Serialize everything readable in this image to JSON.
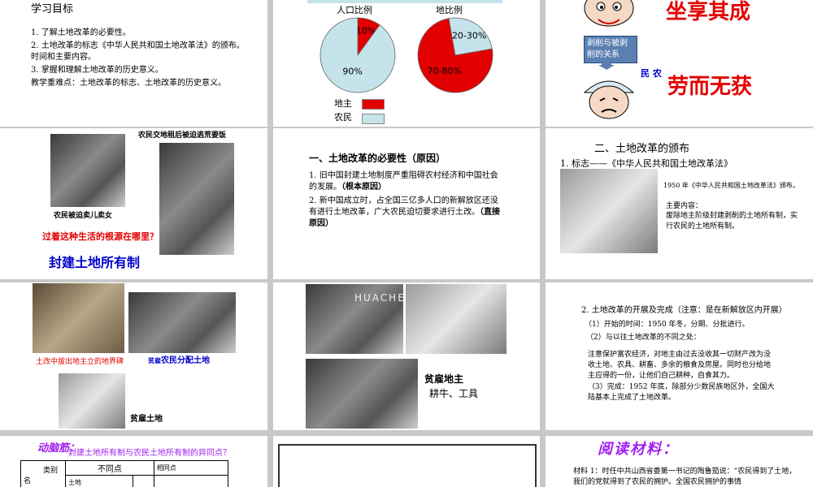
{
  "colors": {
    "red": "#e30000",
    "pale_blue": "#c5e3ea",
    "gray_bg": "#c8c8c8",
    "blue_label": "#0000cc",
    "purple": "#a020f0"
  },
  "s1": {
    "title": "学习目标",
    "items": [
      "1. 了解土地改革的必要性。",
      "2. 土地改革的标志《中华人民共和国土地改革法》的颁布。时间和主要内容。",
      "3. 掌握和理解土地改革的历史意义。"
    ],
    "key": "教学重难点：土地改革的标志、土地改革的历史意义。"
  },
  "s2": {
    "pie1_title": "人口比例",
    "pie2_title": "地比例",
    "legend_landlord": "地主",
    "legend_peasant": "农民"
  },
  "chart_data": [
    {
      "type": "pie",
      "title": "人口比例",
      "labels": [
        "地主",
        "农民"
      ],
      "values": [
        10,
        90
      ],
      "value_labels": [
        "10%",
        "90%"
      ]
    },
    {
      "type": "pie",
      "title": "地比例",
      "labels": [
        "地主",
        "农民"
      ],
      "values": [
        75,
        25
      ],
      "value_labels": [
        "70-80%",
        "20-30%"
      ]
    }
  ],
  "s3": {
    "top_text": "坐享其成",
    "box_label": "剥削与被剥削的关系",
    "peasant_label": "民 农",
    "bottom_text": "劳而无获",
    "head_icon": "landlord-cartoon",
    "peasant_icon": "peasant-cartoon"
  },
  "s4": {
    "caption_top": "农民交地租后被迫逃荒要饭",
    "caption_left": "农民被迫卖儿卖女",
    "question": "过着这种生活的根源在哪里？",
    "answer": "封建土地所有制"
  },
  "s5": {
    "heading": "一、土地改革的必要性（原因）",
    "p1": "1. 旧中国封建土地制度严重阻碍农村经济和中国社会的发展。",
    "p1_tag": "（根本原因）",
    "p2": "2. 新中国成立时，占全国三亿多人口的新解放区还没有进行土地改革，广大农民迫切要求进行土改。",
    "p2_tag": "（直接原因）"
  },
  "s6": {
    "heading": "二、土地改革的颁布",
    "sub": "1. 标志——《中华人民共和国土地改革法》",
    "note1": "1950 年《中华人民共和国土地改革法》颁布。",
    "note2": "主要内容：",
    "note3": "废除地主阶级封建剥削的土地所有制，实行农民的土地所有制。"
  },
  "s7": {
    "caption1": "土改中拔出地主立的地界碑",
    "caption2": "农民分配土地",
    "caption2_prefix": "贫雇",
    "caption3": "贫雇土地"
  },
  "s8": {
    "watermark": "HUACHEN",
    "caption_a": "贫雇地主",
    "caption_b": "耕牛、工具"
  },
  "s9": {
    "heading": "2. 土地改革的开展及完成（注意：是在新解放区内开展）",
    "l1": "（1）开始的时间：1950 年冬，分期、分批进行。",
    "l2": "（2）与以往土地改革的不同之处：",
    "l3": "注意保护富农经济，对地主由过去没收其一切财产改为没收土地、农具、耕畜、多余的粮食及房屋。同时也分给地主应得的一份，让他们自己耕种，自食其力。",
    "l4": "（3）完成：1952 年底，除部分少数民族地区外，全国大陆基本上完成了土地改革。"
  },
  "s10": {
    "title": "动脑筋：",
    "question": "封建土地所有制与农民土地所有制的异同点？",
    "h_cat": "类别",
    "h_diff": "不同点",
    "h_same": "相同点",
    "row_name": "名",
    "row_cell": "土地"
  },
  "s12": {
    "title": "阅读材料：",
    "text": "材料 1：时任中共山西省委第一书记的陶鲁笳说：“农民得到了土地，我们的党就得到了农民的拥护。全国农民拥护的事情"
  }
}
